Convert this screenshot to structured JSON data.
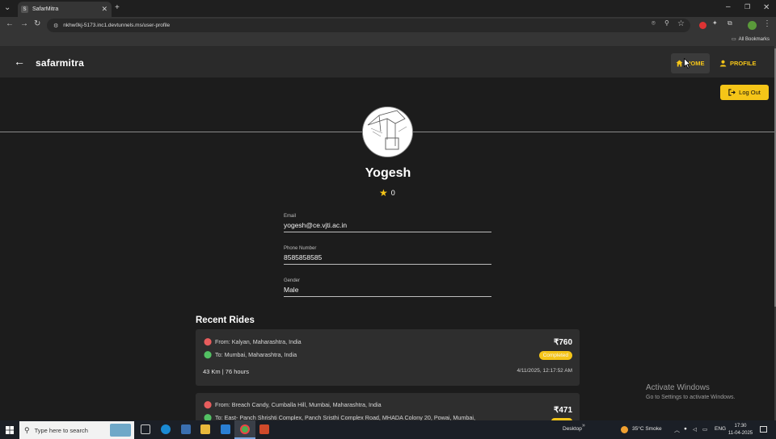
{
  "browser": {
    "tab_title": "SafarMitra",
    "tab_favicon": "S",
    "url": "nkhw0kj-5173.inc1.devtunnels.ms/user-profile",
    "bookmarks_label": "All Bookmarks",
    "icons": [
      "tab-search-icon",
      "new-tab-icon",
      "minimize-icon",
      "maximize-icon",
      "close-window-icon",
      "back-icon",
      "forward-icon",
      "reload-icon",
      "site-info-icon",
      "location-icon",
      "zoom-icon",
      "bookmark-star-icon",
      "extensions-icon",
      "profile-icon",
      "menu-icon",
      "folder-icon"
    ]
  },
  "nav": {
    "brand": "safarmitra",
    "home_label": "HOME",
    "profile_label": "PROFILE",
    "icons": [
      "back-arrow-icon",
      "home-icon",
      "person-icon"
    ]
  },
  "logout_label": "Log Out",
  "profile": {
    "name": "Yogesh",
    "rating": "0",
    "fields": [
      {
        "label": "Email",
        "value": "yogesh@ce.vjti.ac.in"
      },
      {
        "label": "Phone Number",
        "value": "8585858585"
      },
      {
        "label": "Gender",
        "value": "Male"
      }
    ]
  },
  "recent_rides": {
    "title": "Recent Rides",
    "rides": [
      {
        "from": "From: Kalyan, Maharashtra, India",
        "to": "To: Mumbai, Maharashtra, India",
        "price": "₹760",
        "status": "Completed",
        "meta": "43 Km | 76 hours",
        "date": "4/11/2025, 12:17:52 AM"
      },
      {
        "from": "From: Breach Candy, Cumballa Hill, Mumbai, Maharashtra, India",
        "to": "To: East- Panch Shrishti Complex, Panch Sristhi Complex Road, MHADA Colony 20, Powai, Mumbai,",
        "price": "₹471",
        "status": ""
      }
    ]
  },
  "watermark": {
    "line1": "Activate Windows",
    "line2": "Go to Settings to activate Windows."
  },
  "taskbar": {
    "search_placeholder": "Type here to search",
    "desktop_label": "Desktop",
    "weather": "35°C  Smoke",
    "lang": "ENG",
    "time": "17:30",
    "date": "11-04-2025"
  },
  "colors": {
    "accent": "#f5c518",
    "background": "#1c1c1c",
    "navbar": "#2a2a2a",
    "card": "#2e2e2e",
    "pin_from": "#e85d5d",
    "pin_to": "#53c163"
  }
}
